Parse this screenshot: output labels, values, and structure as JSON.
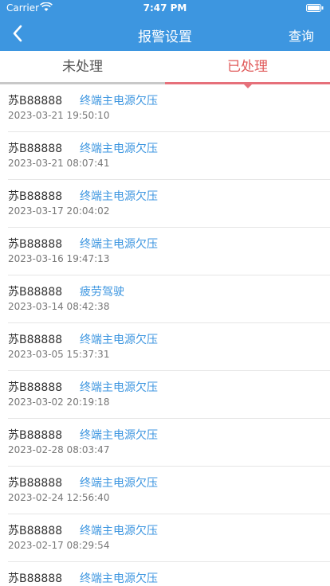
{
  "status_bar": {
    "carrier": "Carrier",
    "time": "7:47 PM"
  },
  "nav": {
    "title": "报警设置",
    "query": "查询"
  },
  "tabs": [
    {
      "label": "未处理",
      "active": false
    },
    {
      "label": "已处理",
      "active": true
    }
  ],
  "colors": {
    "primary": "#3d96e0",
    "active_tab": "#e05a5a"
  },
  "alarms": [
    {
      "plate": "苏B88888",
      "type": "终端主电源欠压",
      "time": "2023-03-21 19:50:10"
    },
    {
      "plate": "苏B88888",
      "type": "终端主电源欠压",
      "time": "2023-03-21 08:07:41"
    },
    {
      "plate": "苏B88888",
      "type": "终端主电源欠压",
      "time": "2023-03-17 20:04:02"
    },
    {
      "plate": "苏B88888",
      "type": "终端主电源欠压",
      "time": "2023-03-16 19:47:13"
    },
    {
      "plate": "苏B88888",
      "type": "疲劳驾驶",
      "time": "2023-03-14 08:42:38"
    },
    {
      "plate": "苏B88888",
      "type": "终端主电源欠压",
      "time": "2023-03-05 15:37:31"
    },
    {
      "plate": "苏B88888",
      "type": "终端主电源欠压",
      "time": "2023-03-02 20:19:18"
    },
    {
      "plate": "苏B88888",
      "type": "终端主电源欠压",
      "time": "2023-02-28 08:03:47"
    },
    {
      "plate": "苏B88888",
      "type": "终端主电源欠压",
      "time": "2023-02-24 12:56:40"
    },
    {
      "plate": "苏B88888",
      "type": "终端主电源欠压",
      "time": "2023-02-17 08:29:54"
    },
    {
      "plate": "苏B88888",
      "type": "终端主电源欠压",
      "time": ""
    }
  ]
}
